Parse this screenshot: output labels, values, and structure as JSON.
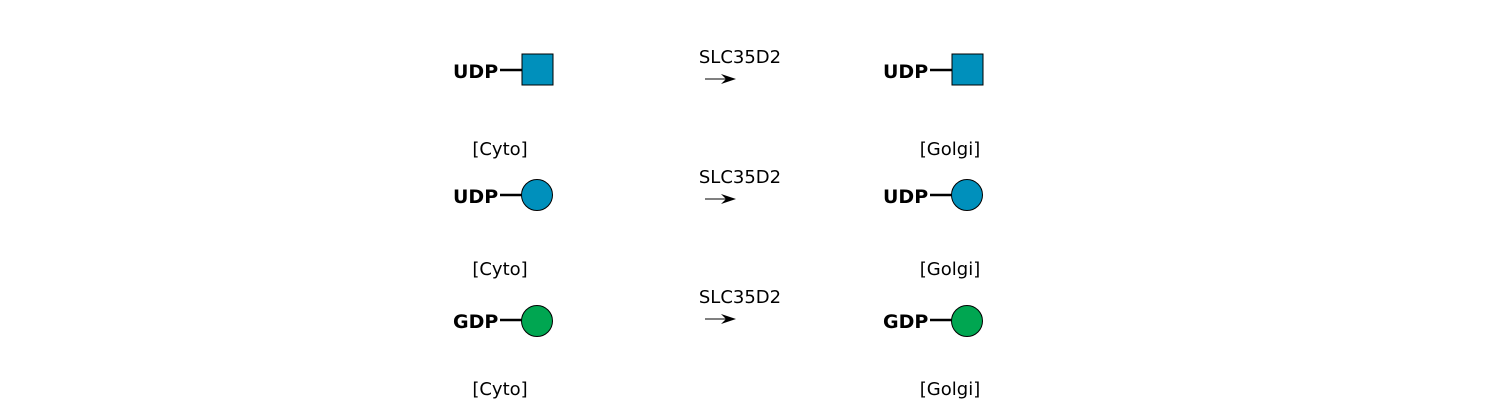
{
  "reactions": [
    {
      "enzyme": "SLC35D2",
      "substrate": {
        "nucleotide": "UDP",
        "glycan_shape": "square",
        "glycan_color": "#0090bc",
        "location": "[Cyto]"
      },
      "product": {
        "nucleotide": "UDP",
        "glycan_shape": "square",
        "glycan_color": "#0090bc",
        "location": "[Golgi]"
      }
    },
    {
      "enzyme": "SLC35D2",
      "substrate": {
        "nucleotide": "UDP",
        "glycan_shape": "circle",
        "glycan_color": "#0090bc",
        "location": "[Cyto]"
      },
      "product": {
        "nucleotide": "UDP",
        "glycan_shape": "circle",
        "glycan_color": "#0090bc",
        "location": "[Golgi]"
      }
    },
    {
      "enzyme": "SLC35D2",
      "substrate": {
        "nucleotide": "GDP",
        "glycan_shape": "circle",
        "glycan_color": "#00a651",
        "location": "[Cyto]"
      },
      "product": {
        "nucleotide": "GDP",
        "glycan_shape": "circle",
        "glycan_color": "#00a651",
        "location": "[Golgi]"
      }
    }
  ]
}
